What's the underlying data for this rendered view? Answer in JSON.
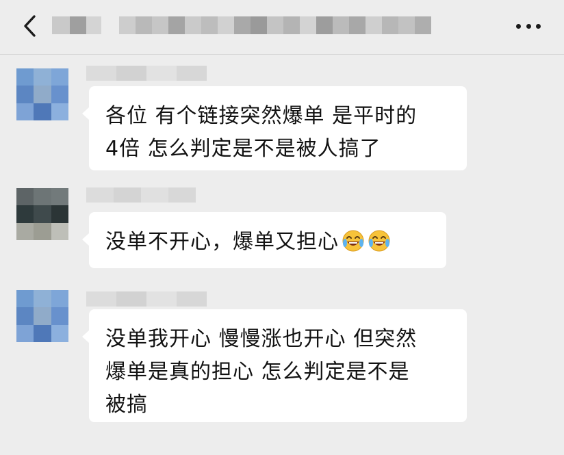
{
  "header": {
    "back_icon": "chevron-left-icon",
    "title_blurred": true,
    "more_icon": "more-dots-icon"
  },
  "messages": [
    {
      "sender_blurred": true,
      "avatar_colors": [
        "#6f9bd0",
        "#8fb1d6",
        "#7ea6d8",
        "#5c86c2",
        "#90abc9",
        "#6891cd",
        "#7ea3d6",
        "#4f78b8",
        "#8cb0de"
      ],
      "text": "各位 有个链接突然爆单 是平时的\n4倍  怎么判定是不是被人搞了"
    },
    {
      "sender_blurred": true,
      "avatar_colors": [
        "#5d6466",
        "#6d7576",
        "#727a7b",
        "#2e3a3c",
        "#3f4a4c",
        "#2b3536",
        "#a9aaa2",
        "#9c9d93",
        "#bebfb8"
      ],
      "text": "没单不开心，爆单又担心",
      "emojis": [
        "face-with-tears-of-joy-icon",
        "face-with-tears-of-joy-icon"
      ]
    },
    {
      "sender_blurred": true,
      "avatar_colors": [
        "#6f9bd0",
        "#8fb1d6",
        "#7ea6d8",
        "#5c86c2",
        "#90abc9",
        "#6891cd",
        "#7ea3d6",
        "#4f78b8",
        "#8cb0de"
      ],
      "text": "没单我开心 慢慢涨也开心 但突然\n爆单是真的担心  怎么判定是不是\n被搞"
    }
  ]
}
